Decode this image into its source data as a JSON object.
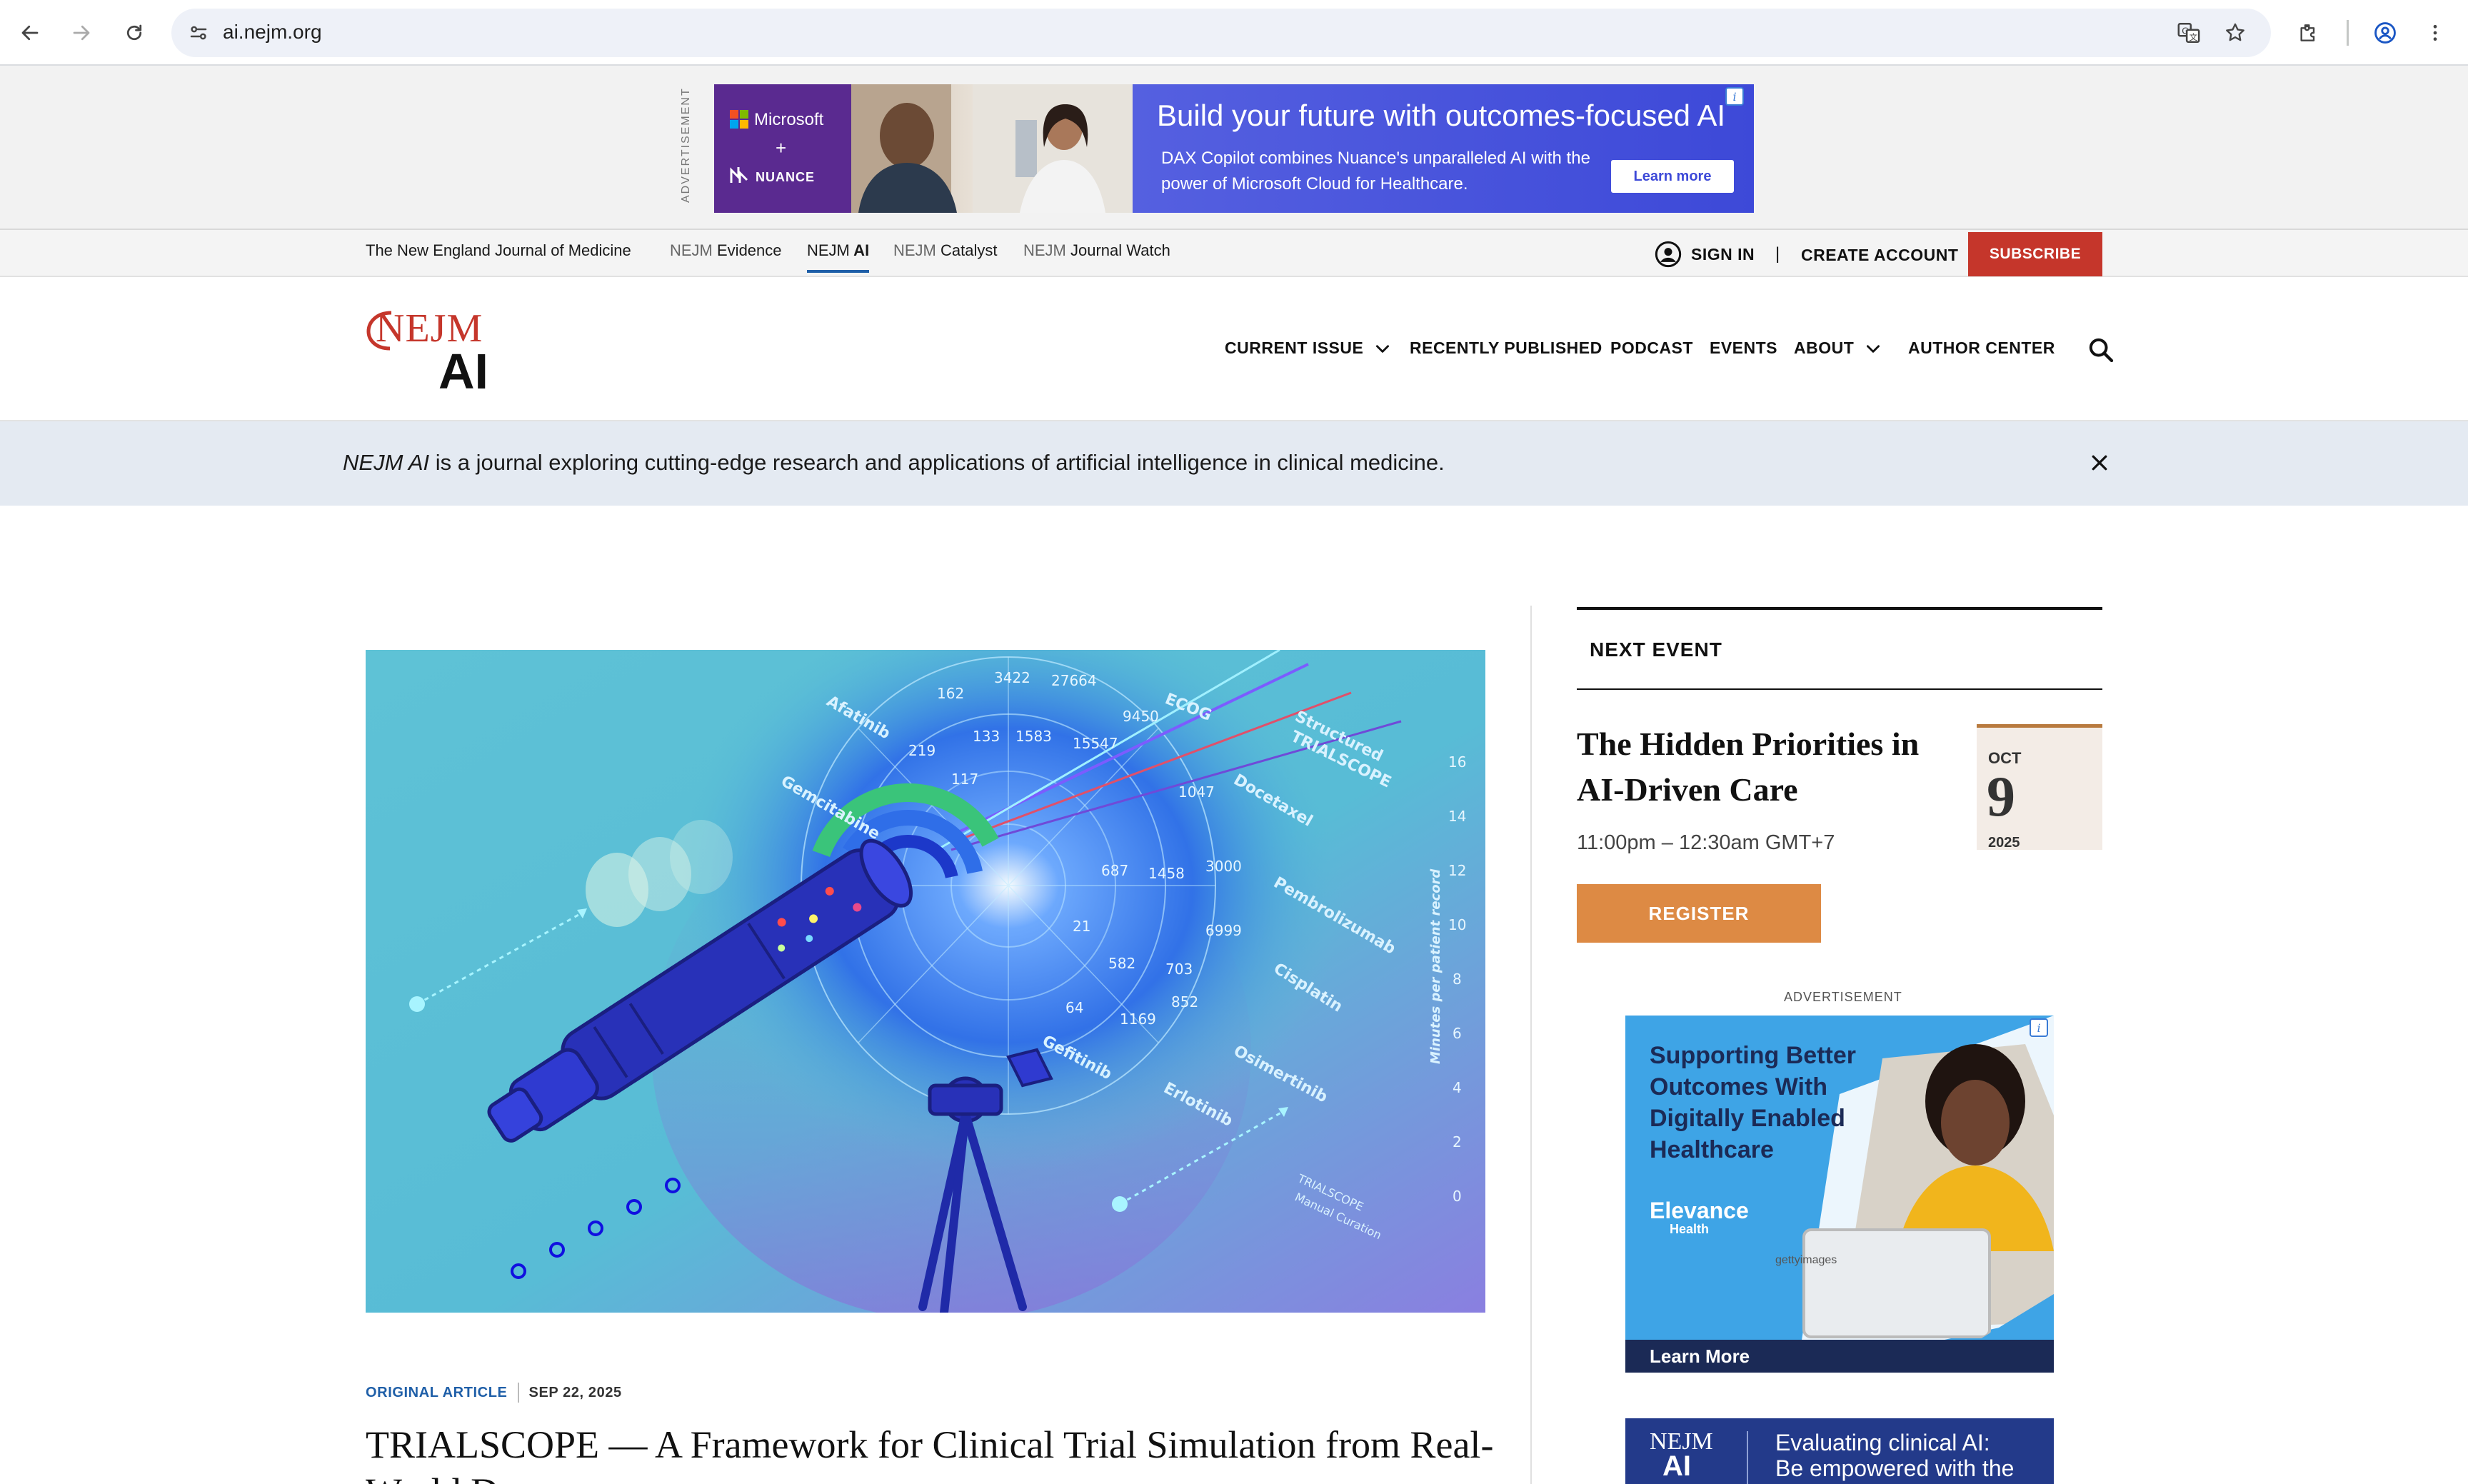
{
  "browser": {
    "url": "ai.nejm.org"
  },
  "top_ad": {
    "vertical_label": "ADVERTISEMENT",
    "brand_line1": "Microsoft",
    "brand_plus": "+",
    "brand_line2": "NUANCE",
    "headline": "Build your future with outcomes-focused AI",
    "subtext": "DAX Copilot combines Nuance's unparalleled AI with the power of Microsoft Cloud for Healthcare.",
    "cta": "Learn more"
  },
  "network_bar": {
    "links": [
      {
        "prefix": "",
        "label": "The New England Journal of Medicine"
      },
      {
        "prefix": "NEJM",
        "label": " Evidence"
      },
      {
        "prefix": "NEJM",
        "label": " AI"
      },
      {
        "prefix": "NEJM",
        "label": " Catalyst"
      },
      {
        "prefix": "NEJM",
        "label": " Journal Watch"
      }
    ],
    "sign_in": "SIGN IN",
    "separator": "|",
    "create_account": "CREATE ACCOUNT",
    "subscribe": "SUBSCRIBE"
  },
  "header": {
    "logo_top": "NEJM",
    "logo_bottom": "AI",
    "nav": [
      "CURRENT ISSUE",
      "RECENTLY PUBLISHED",
      "PODCAST",
      "EVENTS",
      "ABOUT",
      "AUTHOR CENTER"
    ]
  },
  "info_banner": {
    "em": "NEJM AI",
    "text": " is a journal exploring cutting-edge research and applications of artificial intelligence in clinical medicine."
  },
  "feature": {
    "hero_labels": [
      "ECOG",
      "Structured",
      "TRIALSCOPE",
      "Docetaxel",
      "Pembrolizumab",
      "Cisplatin",
      "Osimertinib",
      "Erlotinib",
      "Gefitinib",
      "Afatinib",
      "Gemcitabine",
      "Minutes per patient record",
      "TRIALSCOPE",
      "Manual Curation"
    ],
    "hero_numbers": [
      "3422",
      "27664",
      "162",
      "9450",
      "219",
      "133",
      "1583",
      "15547",
      "117",
      "1047",
      "1458",
      "3000",
      "687",
      "6999",
      "21",
      "582",
      "703",
      "852",
      "64",
      "1169",
      "16",
      "14",
      "12",
      "10",
      "8",
      "6",
      "4",
      "2",
      "0"
    ],
    "kicker_type": "ORIGINAL ARTICLE",
    "kicker_date": "SEP 22, 2025",
    "headline": "TRIALSCOPE — A Framework for Clinical Trial Simulation from Real-World D"
  },
  "sidebar": {
    "next_event_label": "NEXT EVENT",
    "event_title": "The Hidden Priorities in AI-Driven Care",
    "event_time": "11:00pm – 12:30am GMT+7",
    "event_month": "OCT",
    "event_day": "9",
    "event_year": "2025",
    "register": "REGISTER",
    "ad_label": "ADVERTISEMENT",
    "ad1_headline": "Supporting Better Outcomes With Digitally Enabled Healthcare",
    "ad1_brand": "Elevance",
    "ad1_brand_sub": "Health",
    "ad1_photo_credit": "gettyimages",
    "ad1_cta": "Learn More",
    "ad2_logo_top": "NEJM",
    "ad2_logo_bottom": "AI",
    "ad2_text_line1": "Evaluating clinical AI:",
    "ad2_text_line2": "Be empowered with the"
  },
  "colors": {
    "brand_red": "#c5362b",
    "link_blue": "#1f5fa8",
    "register_orange": "#dd8a44",
    "banner_bg": "#e4eaf2"
  }
}
